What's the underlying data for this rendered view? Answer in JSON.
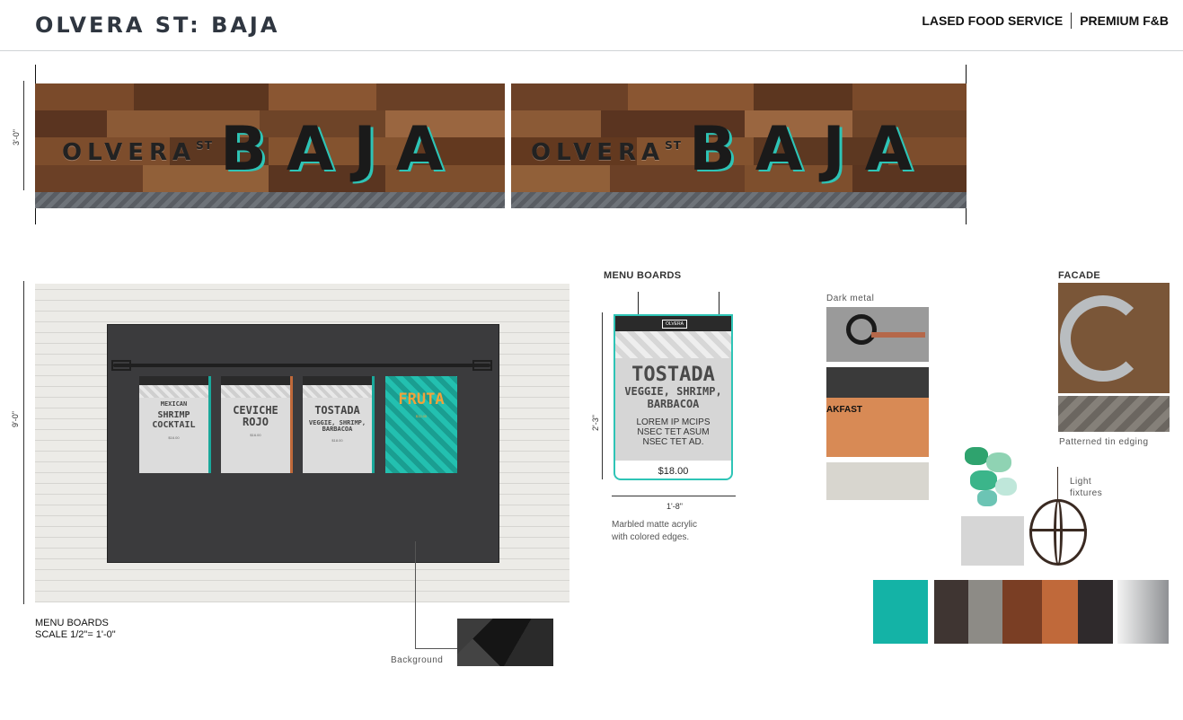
{
  "header": {
    "title": "OLVERA ST: BAJA",
    "company": "LASED FOOD SERVICE",
    "category": "PREMIUM F&B"
  },
  "signage": {
    "olvera": "OLVERA",
    "st": "ST",
    "baja": "BAJA",
    "height_dim": "3'-0\""
  },
  "elevation": {
    "height_dim": "9'-0\"",
    "caption_line1": "MENU BOARDS",
    "caption_line2": "SCALE 1/2\"= 1'-0\"",
    "background_label": "Background",
    "boards": [
      {
        "brand": "OLVERA",
        "title_small": "MEXICAN",
        "title": "SHRIMP COCKTAIL",
        "price": "$16.00"
      },
      {
        "brand": "OLVERA",
        "title_small": "",
        "title": "CEVICHE ROJO",
        "price": "$16.00"
      },
      {
        "brand": "OLVERA",
        "title_small": "",
        "title": "TOSTADA",
        "title_sub": "VEGGIE, SHRIMP, BARBACOA",
        "price": "$18.00"
      },
      {
        "brand": "",
        "title_small": "",
        "title": "FRUTA",
        "price": "$12.00"
      }
    ]
  },
  "menu_boards": {
    "heading": "MENU BOARDS",
    "brand": "OLVERA",
    "title": "TOSTADA",
    "subtitle1": "VEGGIE, SHRIMP,",
    "subtitle2": "BARBACOA",
    "desc1": "LOREM IP MCIPS",
    "desc2": "NSEC TET ASUM",
    "desc3": "NSEC TET AD.",
    "price": "$18.00",
    "height_dim": "2'-3\"",
    "width_dim": "1'-8\"",
    "caption1": "Marbled matte acrylic",
    "caption2": "with colored edges."
  },
  "materials": {
    "dark_metal": "Dark metal",
    "facade_heading": "FACADE",
    "patterned_tin": "Patterned tin edging",
    "light_fixtures1": "Light",
    "light_fixtures2": "fixtures",
    "breakfast_text": "AKFAST",
    "palette": [
      "#14b3a6",
      "#3f3532",
      "#8d8b86",
      "#7a3e24",
      "#c0693a",
      "#2f2a2c",
      "#b9bbbd"
    ]
  }
}
